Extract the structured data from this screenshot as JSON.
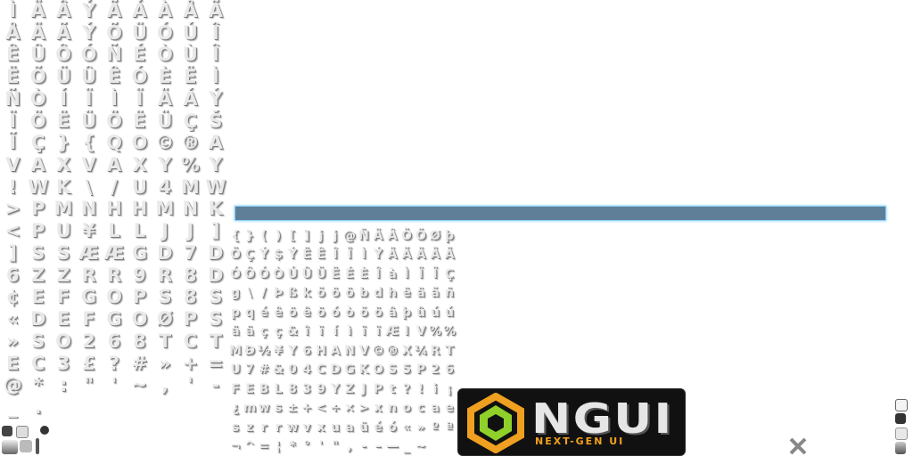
{
  "atlas_left_glyphs": [
    "Ì",
    "Ä",
    "Â",
    "Ý",
    "Ã",
    "Á",
    "À",
    "Å",
    "Ã",
    "Å",
    "Ä",
    "Ã",
    "Ý",
    "Õ",
    "Ü",
    "Ó",
    "Ú",
    "Î",
    "Ê",
    "Û",
    "Ô",
    "Ó",
    "Ñ",
    "É",
    "Ò",
    "Ù",
    "Î",
    "Ë",
    "Õ",
    "Ü",
    "Û",
    "Ê",
    "Ó",
    "È",
    "Ë",
    "Ì",
    "Ñ",
    "Ò",
    "Í",
    "Ï",
    "Ì",
    "Ï",
    "Ä",
    "Á",
    "Ý",
    "Ï",
    "Ö",
    "Ë",
    "Ü",
    "Ö",
    "Ë",
    "Ü",
    "Ç",
    "Š",
    "Ĩ",
    "Ç",
    "}",
    "{",
    "Q",
    "O",
    "©",
    "®",
    "A",
    "V",
    "A",
    "X",
    "V",
    "A",
    "X",
    "Y",
    "%",
    "Y",
    "!",
    "W",
    "K",
    "\\",
    "/",
    "U",
    "4",
    "M",
    "W",
    ">",
    "P",
    "M",
    "N",
    "H",
    "H",
    "M",
    "N",
    "K",
    "<",
    "P",
    "U",
    "¥",
    "L",
    "L",
    "J",
    "J",
    "]",
    "]",
    "S",
    "S",
    "Æ",
    "Æ",
    "G",
    "D",
    "7",
    "D",
    "6",
    "Z",
    "Z",
    "R",
    "R",
    "9",
    "R",
    "8",
    "D",
    "¢",
    "E",
    "F",
    "G",
    "O",
    "P",
    "S",
    "8",
    "S",
    "«",
    "D",
    "E",
    "F",
    "G",
    "O",
    "Ø",
    "P",
    "S",
    "»",
    "S",
    "O",
    "2",
    "6",
    "8",
    "T",
    "C",
    "T",
    "E",
    "C",
    "3",
    "£",
    "?",
    "#",
    "»",
    "+",
    "=",
    "@",
    "*",
    ":",
    "\"",
    "'",
    "~",
    ",",
    "'",
    "-",
    "_",
    "."
  ],
  "atlas_mid_glyphs": [
    "{",
    "}",
    "(",
    ")",
    "[",
    "]",
    "j",
    "j",
    "@",
    "Ñ",
    "Ä",
    "Â",
    "Ö",
    "Õ",
    "Ø",
    "þ",
    "Ö",
    "Ç",
    "Ý",
    "$",
    "Ý",
    "Ë",
    "Ê",
    "Î",
    "Ï",
    "Ì",
    "Ý",
    "Ä",
    "Ã",
    "Ä",
    "Ä",
    "Ä",
    "Ó",
    "Ô",
    "Ó",
    "Ò",
    "Ú",
    "Û",
    "Ü",
    "Ë",
    "É",
    "È",
    "Î",
    "à",
    "Ì",
    "Ï",
    "Ï",
    "Ç",
    "g",
    "\\",
    "/",
    "Þ",
    "ß",
    "k",
    "õ",
    "ö",
    "ö",
    "b",
    "d",
    "h",
    "ë",
    "ä",
    "ã",
    "ñ",
    "p",
    "q",
    "é",
    "ê",
    "ö",
    "ê",
    "ö",
    "ó",
    "ò",
    "õ",
    "ö",
    "â",
    "þ",
    "û",
    "ú",
    "ú",
    "ä",
    "ä",
    "ç",
    "ç",
    "&",
    "î",
    "ï",
    "í",
    "ì",
    "ï",
    "ï",
    "Æ",
    "I",
    "V",
    "%",
    "%",
    "M",
    "Ð",
    "½",
    "¥",
    "Y",
    "6",
    "H",
    "A",
    "N",
    "V",
    "©",
    "®",
    "X",
    "¼",
    "R",
    "T",
    "U",
    "7",
    "#",
    "&",
    "0",
    "4",
    "C",
    "D",
    "G",
    "K",
    "O",
    "S",
    "5",
    "P",
    "2",
    "6",
    "F",
    "E",
    "B",
    "L",
    "8",
    "3",
    "9",
    "Y",
    "Z",
    "J",
    "P",
    "t",
    "?",
    "!",
    "i",
    "¡",
    "¿",
    "m",
    "w",
    "s",
    "±",
    "+",
    "<",
    "÷",
    "×",
    ">",
    "x",
    "n",
    "o",
    "c",
    "a",
    "e",
    "s",
    "z",
    "r",
    "r",
    "w",
    "v",
    "x",
    "u",
    "a",
    "ü",
    "é",
    "ó",
    "«",
    "»",
    "º",
    "ª",
    "¬",
    "^",
    "=",
    "¦",
    "*",
    "°",
    "'",
    "\"",
    ",",
    "-",
    "–",
    "—",
    "_",
    "~"
  ],
  "logo": {
    "wordmark": "NGUI",
    "tagline": "NEXT-GEN UI"
  },
  "colors": {
    "bar_fill": "#5f7f99",
    "bar_glow": "#8ccfff",
    "logo_bg": "#111111",
    "logo_accent": "#f0a020",
    "hex_green": "#8fd12a"
  }
}
